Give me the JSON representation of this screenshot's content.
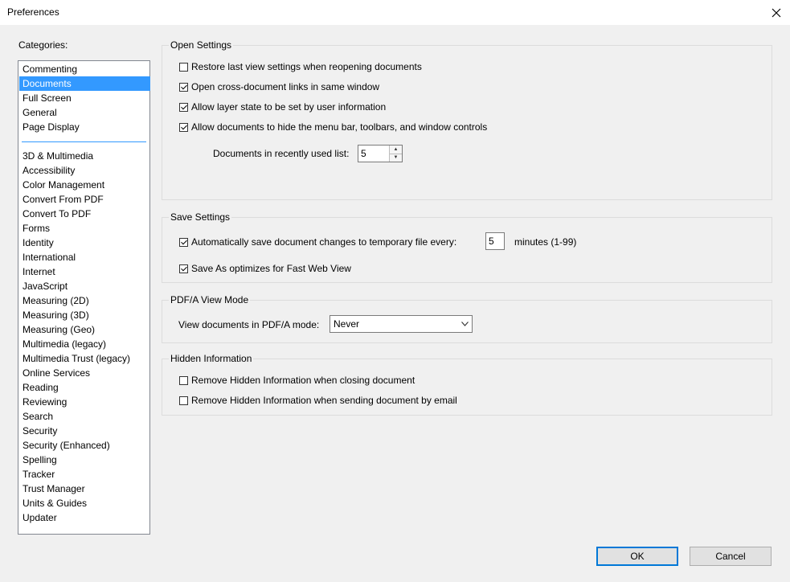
{
  "window": {
    "title": "Preferences"
  },
  "categories": {
    "label": "Categories:",
    "primary": [
      "Commenting",
      "Documents",
      "Full Screen",
      "General",
      "Page Display"
    ],
    "secondary": [
      "3D & Multimedia",
      "Accessibility",
      "Color Management",
      "Convert From PDF",
      "Convert To PDF",
      "Forms",
      "Identity",
      "International",
      "Internet",
      "JavaScript",
      "Measuring (2D)",
      "Measuring (3D)",
      "Measuring (Geo)",
      "Multimedia (legacy)",
      "Multimedia Trust (legacy)",
      "Online Services",
      "Reading",
      "Reviewing",
      "Search",
      "Security",
      "Security (Enhanced)",
      "Spelling",
      "Tracker",
      "Trust Manager",
      "Units & Guides",
      "Updater"
    ],
    "selected": "Documents"
  },
  "open_settings": {
    "title": "Open Settings",
    "restore_last_view": {
      "label": "Restore last view settings when reopening documents",
      "checked": false
    },
    "cross_doc_links": {
      "label": "Open cross-document links in same window",
      "checked": true
    },
    "layer_state": {
      "label": "Allow layer state to be set by user information",
      "checked": true
    },
    "hide_menu_bar": {
      "label": "Allow documents to hide the menu bar, toolbars, and window controls",
      "checked": true
    },
    "recent_list": {
      "label": "Documents in recently used list:",
      "value": "5"
    }
  },
  "save_settings": {
    "title": "Save Settings",
    "auto_save": {
      "label": "Automatically save document changes to temporary file every:",
      "checked": true,
      "value": "5",
      "suffix": "minutes (1-99)"
    },
    "fast_web_view": {
      "label": "Save As optimizes for Fast Web View",
      "checked": true
    }
  },
  "pdfa_view_mode": {
    "title": "PDF/A View Mode",
    "label": "View documents in PDF/A mode:",
    "value": "Never"
  },
  "hidden_info": {
    "title": "Hidden Information",
    "on_close": {
      "label": "Remove Hidden Information when closing document",
      "checked": false
    },
    "on_email": {
      "label": "Remove Hidden Information when sending document by email",
      "checked": false
    }
  },
  "buttons": {
    "ok": "OK",
    "cancel": "Cancel"
  },
  "icons": {
    "close": "close-icon",
    "spin_up": "chevron-up-icon",
    "spin_down": "chevron-down-icon",
    "dropdown": "chevron-down-icon"
  }
}
